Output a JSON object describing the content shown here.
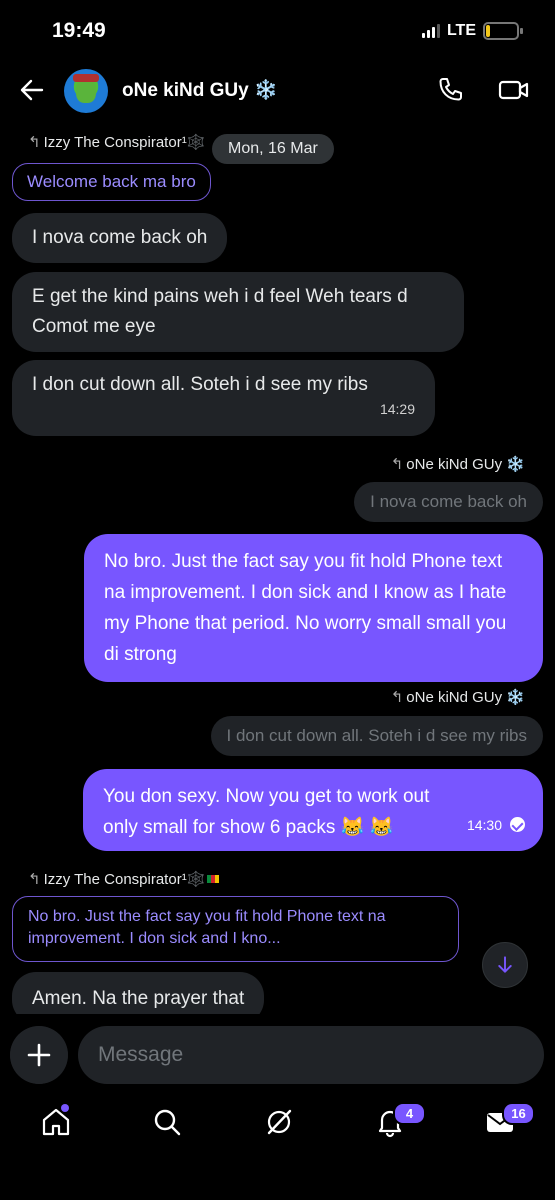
{
  "status": {
    "time": "19:49",
    "network": "LTE",
    "battery": "14",
    "battery_level": 0.14
  },
  "header": {
    "name": "oNe kiNd GUy",
    "name_emoji": "❄️"
  },
  "messages": [
    {
      "reply_to": "Izzy The Conspirator¹🕸️",
      "quoted": "Welcome back ma bro"
    },
    {
      "date": "Mon, 16 Mar"
    },
    {
      "text": "I nova come back oh"
    },
    {
      "text": "E get the kind pains weh i d feel Weh tears d Comot me eye"
    },
    {
      "text": "I don cut down all. Soteh i d see my ribs",
      "time": "14:29"
    },
    {
      "reply_to": "oNe kiNd GUy ❄️",
      "quoted": "I nova come back oh"
    },
    {
      "text": "No bro. Just the fact say you fit hold Phone text na improvement. I don sick and I know as I hate my Phone that period. No worry small small you di strong"
    },
    {
      "reply_to": "oNe kiNd GUy ❄️",
      "quoted": "I don cut down all. Soteh i d see my ribs"
    },
    {
      "text": "You don sexy. Now you get to work out only small for show 6 packs 😹 😹",
      "time": "14:30"
    },
    {
      "reply_to": "Izzy The Conspirator¹🕸️",
      "quoted": "No bro. Just the fact say you fit hold Phone text na improvement. I don sick and I kno..."
    },
    {
      "text": "Amen. Na the prayer that"
    }
  ],
  "composer": {
    "placeholder": "Message"
  },
  "tabs": {
    "notifications_badge": "4",
    "messages_badge": "16"
  }
}
